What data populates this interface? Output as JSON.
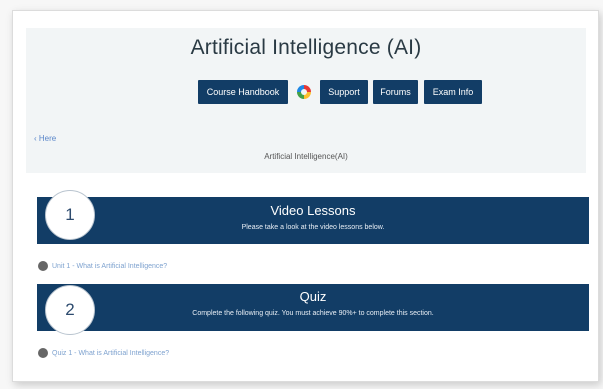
{
  "header": {
    "title": "Artificial Intelligence (AI)",
    "buttons": [
      "Course Handbook",
      "Support",
      "Forums",
      "Exam Info"
    ],
    "back_link": "‹ Here",
    "breadcrumb": "Artificial Intelligence(AI)"
  },
  "sections": [
    {
      "step": "1",
      "title": "Video Lessons",
      "description": "Please take a look at the video lessons below.",
      "link": "Unit 1 - What is Artificial Intelligence?"
    },
    {
      "step": "2",
      "title": "Quiz",
      "description": "Complete the following quiz. You must achieve 90%+ to complete this section.",
      "link": "Quiz 1 - What is Artificial Intelligence?"
    }
  ],
  "colors": {
    "banner": "#123d66",
    "link": "#7ea2cf",
    "header_bg": "#f2f5f6"
  },
  "icons": {
    "loading": "loading-spinner-icon",
    "unit": "circle-icon"
  }
}
